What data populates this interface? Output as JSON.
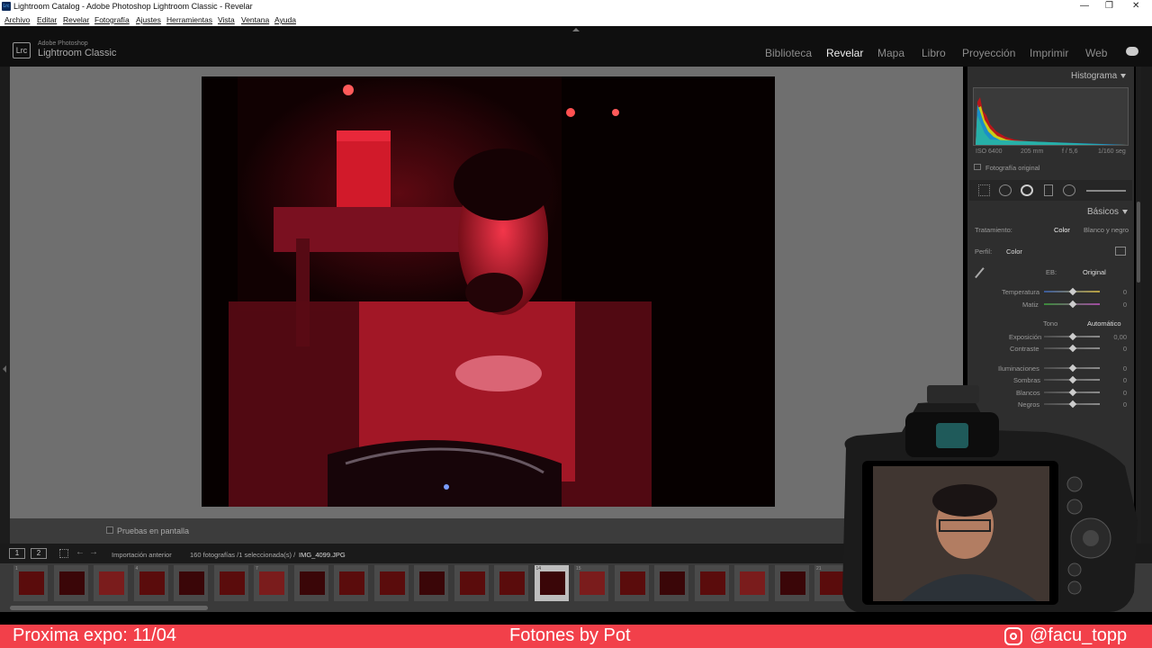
{
  "window": {
    "title": "Lightroom Catalog - Adobe Photoshop Lightroom Classic - Revelar",
    "app_icon": "Lrc"
  },
  "menu": [
    "Archivo",
    "Editar",
    "Revelar",
    "Fotografía",
    "Ajustes",
    "Herramientas",
    "Vista",
    "Ventana",
    "Ayuda"
  ],
  "brand": {
    "logo": "Lrc",
    "line1": "Adobe Photoshop",
    "line2": "Lightroom Classic"
  },
  "modules": [
    "Biblioteca",
    "Revelar",
    "Mapa",
    "Libro",
    "Proyección",
    "Imprimir",
    "Web"
  ],
  "active_module": "Revelar",
  "toolbar": {
    "proof_label": "Pruebas en pantalla"
  },
  "right_panel": {
    "histogram_title": "Histograma",
    "meta": {
      "iso": "ISO 6400",
      "focal": "205 mm",
      "aperture": "f / 5,6",
      "shutter": "1/160 seg"
    },
    "original_label": "Fotografía original",
    "basicos_title": "Básicos",
    "tratamiento_label": "Tratamiento:",
    "tratamiento_color": "Color",
    "tratamiento_bw": "Blanco y negro",
    "perfil_label": "Perfil:",
    "perfil_value": "Color",
    "wb_label": "EB:",
    "wb_value": "Original",
    "tono_label": "Tono",
    "auto_label": "Automático",
    "sliders": [
      {
        "label": "Temperatura",
        "value": "0"
      },
      {
        "label": "Matiz",
        "value": "0"
      },
      {
        "label": "Exposición",
        "value": "0,00"
      },
      {
        "label": "Contraste",
        "value": "0"
      },
      {
        "label": "Iluminaciones",
        "value": "0"
      },
      {
        "label": "Sombras",
        "value": "0"
      },
      {
        "label": "Blancos",
        "value": "0"
      },
      {
        "label": "Negros",
        "value": "0"
      }
    ]
  },
  "filmstrip": {
    "source": "Importación anterior",
    "count": "160 fotografías /1 seleccionada(s) /",
    "filename": "IMG_4099.JPG",
    "page1": "1",
    "page2": "2",
    "cells": [
      "1",
      "",
      "",
      "4",
      "",
      "",
      "7",
      "",
      "",
      "",
      "",
      "",
      "",
      "14",
      "15",
      "",
      "",
      "",
      "",
      "",
      "21"
    ],
    "selected": "14"
  },
  "overlay": {
    "left": "Proxima expo: 11/04",
    "center": "Fotones by Pot",
    "right": "@facu_topp"
  },
  "colors": {
    "banner": "#f2404a",
    "photo_red": "#d01020"
  }
}
